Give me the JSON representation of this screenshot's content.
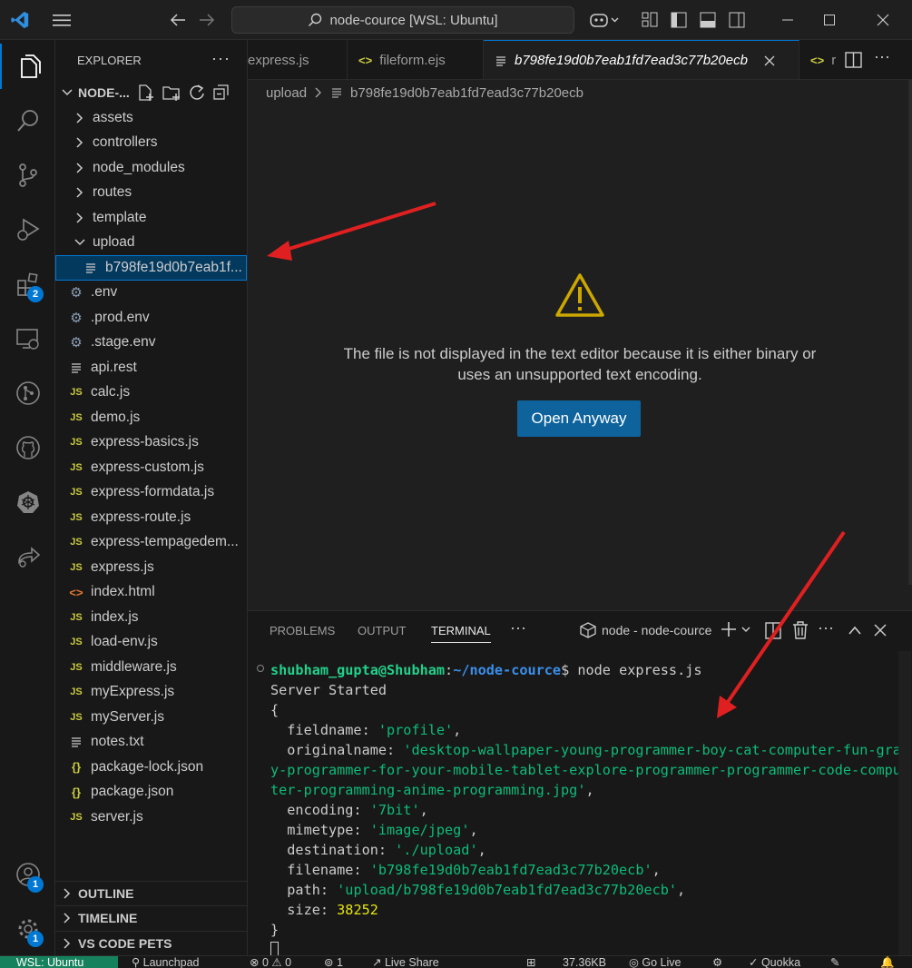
{
  "titlebar": {
    "search_text": "node-cource [WSL: Ubuntu]"
  },
  "activity": {
    "extensions_badge": "2",
    "accounts_badge": "1",
    "settings_badge": "1"
  },
  "explorer": {
    "title": "EXPLORER",
    "project_name": "NODE-...",
    "folders": [
      "assets",
      "controllers",
      "node_modules",
      "routes",
      "template"
    ],
    "open_folder": "upload",
    "selected_file": "b798fe19d0b7eab1f...",
    "files": [
      {
        "name": ".env",
        "icon": "gear"
      },
      {
        "name": ".prod.env",
        "icon": "gear"
      },
      {
        "name": ".stage.env",
        "icon": "gear"
      },
      {
        "name": "api.rest",
        "icon": "lines"
      },
      {
        "name": "calc.js",
        "icon": "js"
      },
      {
        "name": "demo.js",
        "icon": "js"
      },
      {
        "name": "express-basics.js",
        "icon": "js"
      },
      {
        "name": "express-custom.js",
        "icon": "js"
      },
      {
        "name": "express-formdata.js",
        "icon": "js"
      },
      {
        "name": "express-route.js",
        "icon": "js"
      },
      {
        "name": "express-tempagedem...",
        "icon": "js"
      },
      {
        "name": "express.js",
        "icon": "js"
      },
      {
        "name": "index.html",
        "icon": "html"
      },
      {
        "name": "index.js",
        "icon": "js"
      },
      {
        "name": "load-env.js",
        "icon": "js"
      },
      {
        "name": "middleware.js",
        "icon": "js"
      },
      {
        "name": "myExpress.js",
        "icon": "js"
      },
      {
        "name": "myServer.js",
        "icon": "js"
      },
      {
        "name": "notes.txt",
        "icon": "lines"
      },
      {
        "name": "package-lock.json",
        "icon": "json"
      },
      {
        "name": "package.json",
        "icon": "json"
      },
      {
        "name": "server.js",
        "icon": "js"
      }
    ],
    "sections": [
      "OUTLINE",
      "TIMELINE",
      "VS CODE PETS"
    ]
  },
  "tabs": [
    "express.js",
    "fileform.ejs",
    "b798fe19d0b7eab1fd7ead3c77b20ecb",
    "r"
  ],
  "breadcrumb": {
    "folder": "upload",
    "file": "b798fe19d0b7eab1fd7ead3c77b20ecb"
  },
  "editor": {
    "message_line1": "The file is not displayed in the text editor because it is either binary or",
    "message_line2": "uses an unsupported text encoding.",
    "open_button": "Open Anyway"
  },
  "panel": {
    "tabs": [
      "PROBLEMS",
      "OUTPUT",
      "TERMINAL"
    ],
    "active_tab": "TERMINAL",
    "terminal_name": "node - node-cource",
    "prompt_user": "shubham_gupta@Shubham",
    "prompt_path": "~/node-cource",
    "command": "$ node express.js",
    "output": {
      "started": "Server Started",
      "open_brace": "{",
      "fieldname_key": "  fieldname: ",
      "fieldname_val": "'profile'",
      "originalname_key": "  originalname: ",
      "originalname_val1": "'desktop-wallpaper-young-programmer-boy-cat-computer-fun-gra",
      "originalname_val2": "y-programmer-for-your-mobile-tablet-explore-programmer-programmer-code-compu",
      "originalname_val3": "ter-programming-anime-programming.jpg'",
      "encoding_key": "  encoding: ",
      "encoding_val": "'7bit'",
      "mimetype_key": "  mimetype: ",
      "mimetype_val": "'image/jpeg'",
      "destination_key": "  destination: ",
      "destination_val": "'./upload'",
      "filename_key": "  filename: ",
      "filename_val": "'b798fe19d0b7eab1fd7ead3c77b20ecb'",
      "path_key": "  path: ",
      "path_val": "'upload/b798fe19d0b7eab1fd7ead3c77b20ecb'",
      "size_key": "  size: ",
      "size_val": "38252",
      "close_brace": "}"
    }
  },
  "statusbar": {
    "remote": "WSL: Ubuntu",
    "launchpad": "Launchpad",
    "errors": "0",
    "warnings": "0",
    "ports": "1",
    "liveshare": "Live Share",
    "filesize": "37.36KB",
    "golive": "Go Live",
    "quokka": "Quokka"
  }
}
